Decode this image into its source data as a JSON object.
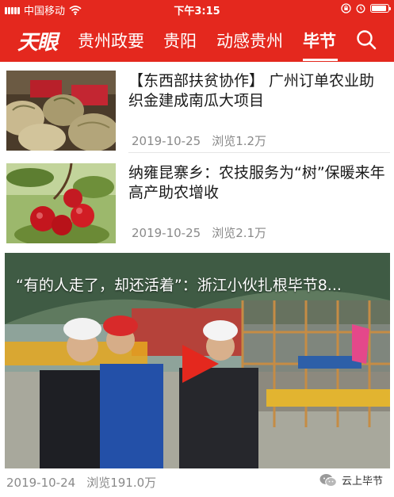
{
  "status_bar": {
    "carrier": "中国移动",
    "time": "下午3:15",
    "battery_level": 0.9,
    "icons": [
      "signal-icon",
      "wifi-icon",
      "lock-rotation-icon",
      "alarm-icon",
      "battery-icon"
    ]
  },
  "nav": {
    "logo": "天眼",
    "tabs": [
      {
        "label": "贵州政要",
        "active": false
      },
      {
        "label": "贵阳",
        "active": false
      },
      {
        "label": "动感贵州",
        "active": false
      },
      {
        "label": "毕节",
        "active": true
      }
    ],
    "search_icon": "search-icon",
    "accent_color": "#e4281e"
  },
  "articles": [
    {
      "title": "【东西部扶贫协作】 广州订单农业助织金建成南瓜大项目",
      "date": "2019-10-25",
      "views": "浏览1.2万",
      "thumbnail": "pumpkin-harvest-image"
    },
    {
      "title": "纳雍昆寨乡：农技服务为“树”保暖来年高产助农增收",
      "date": "2019-10-25",
      "views": "浏览2.1万",
      "thumbnail": "red-fruit-image"
    }
  ],
  "video": {
    "title": "“有的人走了，却还活着”：浙江小伙扎根毕节8...",
    "date": "2019-10-24",
    "views": "浏览191.0万",
    "play_icon": "play-icon",
    "thumbnail": "construction-site-image"
  },
  "watermark": {
    "label": "云上毕节",
    "icon": "wechat-icon"
  }
}
